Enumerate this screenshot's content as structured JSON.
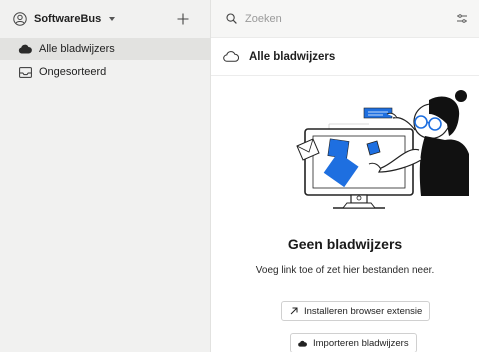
{
  "sidebar": {
    "collection_name": "SoftwareBus",
    "items": [
      {
        "label": "Alle bladwijzers",
        "icon": "cloud-icon",
        "active": true
      },
      {
        "label": "Ongesorteerd",
        "icon": "inbox-icon",
        "active": false
      }
    ]
  },
  "search": {
    "placeholder": "Zoeken"
  },
  "header": {
    "title": "Alle bladwijzers"
  },
  "empty_state": {
    "title": "Geen bladwijzers",
    "subtitle": "Voeg link toe of zet hier bestanden neer.",
    "buttons": [
      {
        "label": "Installeren browser extensie",
        "icon": "arrow-up-right-icon"
      },
      {
        "label": "Importeren bladwijzers",
        "icon": "cloud-icon"
      }
    ]
  },
  "colors": {
    "accent": "#1e6fe0",
    "sidebar_bg": "#f1f1f0",
    "active_item": "#e2e2e0"
  }
}
